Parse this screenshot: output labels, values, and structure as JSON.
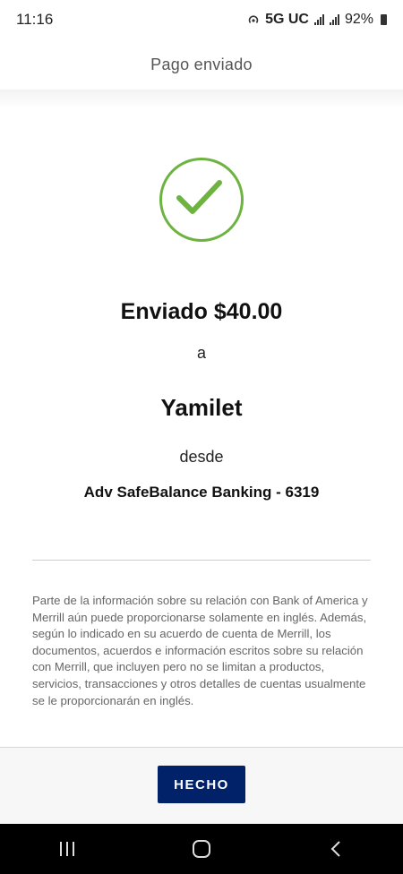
{
  "status_bar": {
    "time": "11:16",
    "network": "5G UC",
    "battery": "92%"
  },
  "header": {
    "title": "Pago enviado"
  },
  "confirmation": {
    "sent_label": "Enviado $40.00",
    "to_word": "a",
    "recipient": "Yamilet",
    "from_word": "desde",
    "account": "Adv SafeBalance Banking - 6319"
  },
  "disclaimer": "Parte de la información sobre su relación con Bank of America y Merrill aún puede proporcionarse solamente en inglés. Además, según lo indicado en su acuerdo de cuenta de Merrill, los documentos, acuerdos e información escritos sobre su relación con Merrill, que incluyen pero no se limitan a productos, servicios, transacciones y otros detalles de cuentas usualmente se le proporcionarán en inglés.",
  "footer": {
    "done_label": "HECHO"
  },
  "nav": {
    "recent_icon": "recent-apps-icon",
    "home_icon": "home-icon",
    "back_icon": "back-icon"
  },
  "colors": {
    "check_green": "#6db33f",
    "button_navy": "#012169"
  }
}
